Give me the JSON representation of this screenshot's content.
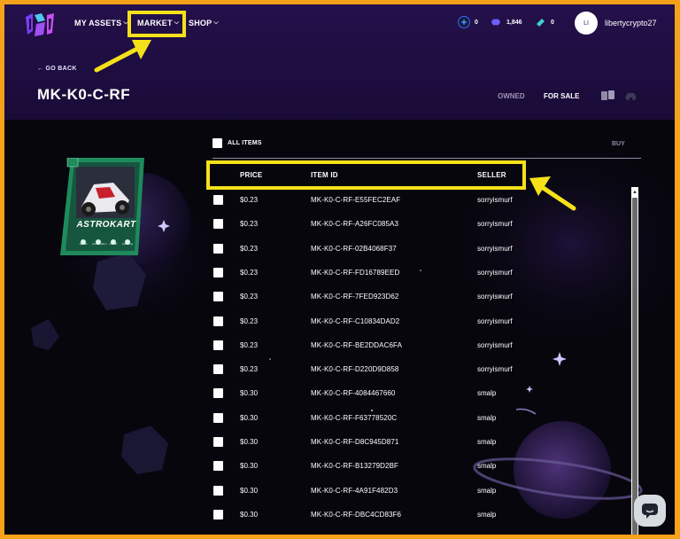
{
  "nav": {
    "my_assets": "MY ASSETS",
    "market": "MARKET",
    "shop": "SHOP"
  },
  "counters": [
    {
      "icon": "star-token-icon",
      "value": "0",
      "color": "#2f6bff"
    },
    {
      "icon": "gem-token-icon",
      "value": "1,846",
      "color": "#6f5cff"
    },
    {
      "icon": "ticket-token-icon",
      "value": "0",
      "color": "#3fd0c8"
    }
  ],
  "user": {
    "initials": "LI",
    "name": "libertycrypto27"
  },
  "back_label": "← GO BACK",
  "title": "MK-K0-C-RF",
  "tabs": {
    "owned": "OWNED",
    "for_sale": "FOR SALE"
  },
  "card": {
    "name": "ASTROKART",
    "stats": [
      "Speed",
      "Acceleration",
      "Health",
      "Handling"
    ],
    "accent": "#1f8a5c"
  },
  "listing": {
    "all_items": "ALL ITEMS",
    "buy": "BUY",
    "headers": {
      "price": "PRICE",
      "item_id": "ITEM ID",
      "seller": "SELLER"
    },
    "rows": [
      {
        "price": "$0.23",
        "id": "MK-K0-C-RF-E55FEC2EAF",
        "seller": "sorryismurf"
      },
      {
        "price": "$0.23",
        "id": "MK-K0-C-RF-A26FC085A3",
        "seller": "sorryismurf"
      },
      {
        "price": "$0.23",
        "id": "MK-K0-C-RF-02B4068F37",
        "seller": "sorryismurf"
      },
      {
        "price": "$0.23",
        "id": "MK-K0-C-RF-FD16789EED",
        "seller": "sorryismurf"
      },
      {
        "price": "$0.23",
        "id": "MK-K0-C-RF-7FED923D62",
        "seller": "sorryismurf"
      },
      {
        "price": "$0.23",
        "id": "MK-K0-C-RF-C10834DAD2",
        "seller": "sorryismurf"
      },
      {
        "price": "$0.23",
        "id": "MK-K0-C-RF-BE2DDAC6FA",
        "seller": "sorryismurf"
      },
      {
        "price": "$0.23",
        "id": "MK-K0-C-RF-D220D9D858",
        "seller": "sorryismurf"
      },
      {
        "price": "$0.30",
        "id": "MK-K0-C-RF-4084467660",
        "seller": "smalp"
      },
      {
        "price": "$0.30",
        "id": "MK-K0-C-RF-F63778520C",
        "seller": "smalp"
      },
      {
        "price": "$0.30",
        "id": "MK-K0-C-RF-D8C945D871",
        "seller": "smalp"
      },
      {
        "price": "$0.30",
        "id": "MK-K0-C-RF-B13279D2BF",
        "seller": "smalp"
      },
      {
        "price": "$0.30",
        "id": "MK-K0-C-RF-4A91F482D3",
        "seller": "smalp"
      },
      {
        "price": "$0.30",
        "id": "MK-K0-C-RF-DBC4CD83F6",
        "seller": "smalp"
      }
    ]
  },
  "annotation_color": "#f5e11a"
}
